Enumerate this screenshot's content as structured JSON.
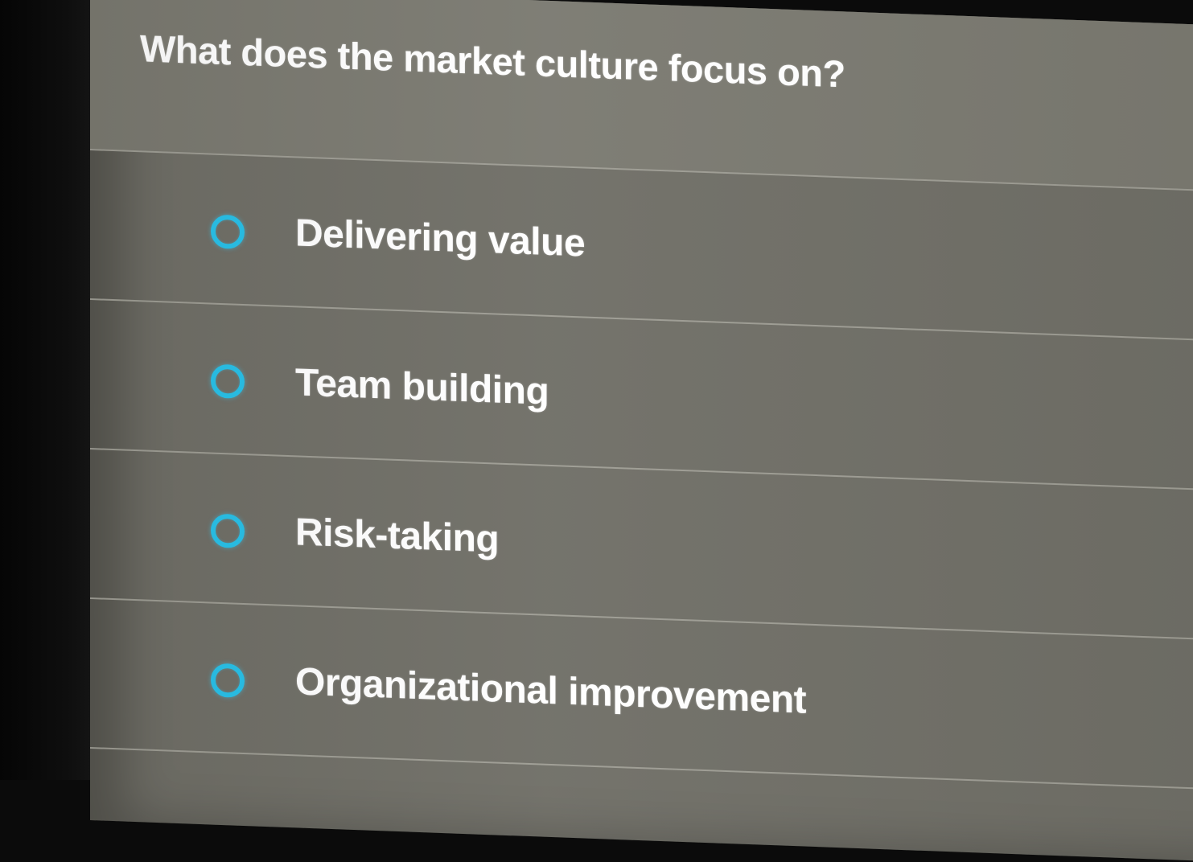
{
  "question": {
    "text": "What does the market culture focus on?"
  },
  "options": [
    {
      "label": "Delivering value",
      "selected": false
    },
    {
      "label": "Team building",
      "selected": false
    },
    {
      "label": "Risk-taking",
      "selected": false
    },
    {
      "label": "Organizational improvement",
      "selected": false
    }
  ],
  "colors": {
    "background": "#6f6e66",
    "radio_accent": "#27c0e8",
    "text": "#ffffff"
  }
}
